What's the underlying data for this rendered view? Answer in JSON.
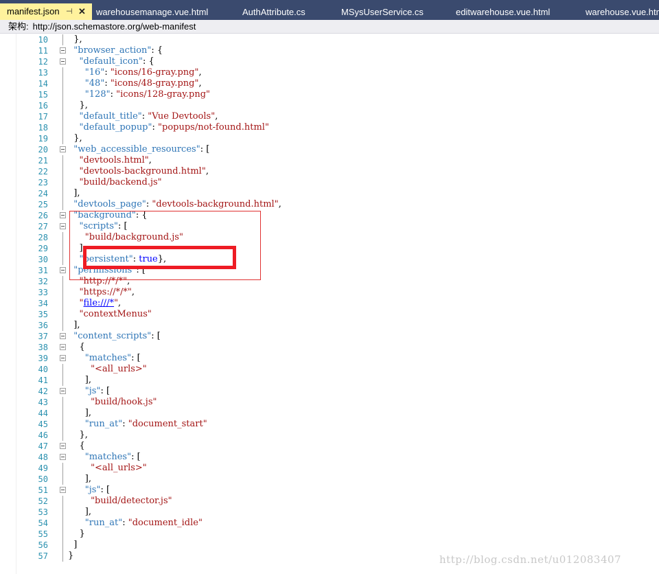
{
  "tabs": [
    {
      "label": "manifest.json",
      "active": true
    },
    {
      "label": "warehousemanage.vue.html"
    },
    {
      "label": "AuthAttribute.cs"
    },
    {
      "label": "MSysUserService.cs"
    },
    {
      "label": "editwarehouse.vue.html"
    },
    {
      "label": "warehouse.vue.html"
    }
  ],
  "tab_icons": {
    "pin": "pin-icon",
    "close": "close-icon"
  },
  "schema": {
    "label": "架构:",
    "url": "http://json.schemastore.org/web-manifest"
  },
  "colors": {
    "tabbar_bg": "#3a4a6e",
    "active_tab_bg": "#fff29d",
    "line_number": "#2b91af",
    "json_key": "#2e75b6",
    "json_string": "#a31515",
    "json_keyword": "#0000ff",
    "highlight_red": "#ee1c24"
  },
  "lines": [
    {
      "n": "10",
      "fold": false,
      "tokens": [
        {
          "t": "p",
          "s": "  },"
        }
      ]
    },
    {
      "n": "11",
      "fold": true,
      "tokens": [
        {
          "t": "p",
          "s": "  "
        },
        {
          "t": "key",
          "s": "\"browser_action\""
        },
        {
          "t": "p",
          "s": ": {"
        }
      ]
    },
    {
      "n": "12",
      "fold": true,
      "tokens": [
        {
          "t": "p",
          "s": "    "
        },
        {
          "t": "key",
          "s": "\"default_icon\""
        },
        {
          "t": "p",
          "s": ": {"
        }
      ]
    },
    {
      "n": "13",
      "fold": false,
      "tokens": [
        {
          "t": "p",
          "s": "      "
        },
        {
          "t": "key",
          "s": "\"16\""
        },
        {
          "t": "p",
          "s": ": "
        },
        {
          "t": "str",
          "s": "\"icons/16-gray.png\""
        },
        {
          "t": "p",
          "s": ","
        }
      ]
    },
    {
      "n": "14",
      "fold": false,
      "tokens": [
        {
          "t": "p",
          "s": "      "
        },
        {
          "t": "key",
          "s": "\"48\""
        },
        {
          "t": "p",
          "s": ": "
        },
        {
          "t": "str",
          "s": "\"icons/48-gray.png\""
        },
        {
          "t": "p",
          "s": ","
        }
      ]
    },
    {
      "n": "15",
      "fold": false,
      "tokens": [
        {
          "t": "p",
          "s": "      "
        },
        {
          "t": "key",
          "s": "\"128\""
        },
        {
          "t": "p",
          "s": ": "
        },
        {
          "t": "str",
          "s": "\"icons/128-gray.png\""
        }
      ]
    },
    {
      "n": "16",
      "fold": false,
      "tokens": [
        {
          "t": "p",
          "s": "    },"
        }
      ]
    },
    {
      "n": "17",
      "fold": false,
      "tokens": [
        {
          "t": "p",
          "s": "    "
        },
        {
          "t": "key",
          "s": "\"default_title\""
        },
        {
          "t": "p",
          "s": ": "
        },
        {
          "t": "str",
          "s": "\"Vue Devtools\""
        },
        {
          "t": "p",
          "s": ","
        }
      ]
    },
    {
      "n": "18",
      "fold": false,
      "tokens": [
        {
          "t": "p",
          "s": "    "
        },
        {
          "t": "key",
          "s": "\"default_popup\""
        },
        {
          "t": "p",
          "s": ": "
        },
        {
          "t": "str",
          "s": "\"popups/not-found.html\""
        }
      ]
    },
    {
      "n": "19",
      "fold": false,
      "tokens": [
        {
          "t": "p",
          "s": "  },"
        }
      ]
    },
    {
      "n": "20",
      "fold": true,
      "tokens": [
        {
          "t": "p",
          "s": "  "
        },
        {
          "t": "key",
          "s": "\"web_accessible_resources\""
        },
        {
          "t": "p",
          "s": ": ["
        }
      ]
    },
    {
      "n": "21",
      "fold": false,
      "tokens": [
        {
          "t": "p",
          "s": "    "
        },
        {
          "t": "str",
          "s": "\"devtools.html\""
        },
        {
          "t": "p",
          "s": ","
        }
      ]
    },
    {
      "n": "22",
      "fold": false,
      "tokens": [
        {
          "t": "p",
          "s": "    "
        },
        {
          "t": "str",
          "s": "\"devtools-background.html\""
        },
        {
          "t": "p",
          "s": ","
        }
      ]
    },
    {
      "n": "23",
      "fold": false,
      "tokens": [
        {
          "t": "p",
          "s": "    "
        },
        {
          "t": "str",
          "s": "\"build/backend.js\""
        }
      ]
    },
    {
      "n": "24",
      "fold": false,
      "tokens": [
        {
          "t": "p",
          "s": "  ],"
        }
      ]
    },
    {
      "n": "25",
      "fold": false,
      "tokens": [
        {
          "t": "p",
          "s": "  "
        },
        {
          "t": "key",
          "s": "\"devtools_page\""
        },
        {
          "t": "p",
          "s": ": "
        },
        {
          "t": "str",
          "s": "\"devtools-background.html\""
        },
        {
          "t": "p",
          "s": ","
        }
      ]
    },
    {
      "n": "26",
      "fold": true,
      "tokens": [
        {
          "t": "p",
          "s": "  "
        },
        {
          "t": "key",
          "s": "\"background\""
        },
        {
          "t": "p",
          "s": ": {"
        }
      ]
    },
    {
      "n": "27",
      "fold": true,
      "tokens": [
        {
          "t": "p",
          "s": "    "
        },
        {
          "t": "key",
          "s": "\"scripts\""
        },
        {
          "t": "p",
          "s": ": ["
        }
      ]
    },
    {
      "n": "28",
      "fold": false,
      "tokens": [
        {
          "t": "p",
          "s": "      "
        },
        {
          "t": "str",
          "s": "\"build/background.js\""
        }
      ]
    },
    {
      "n": "29",
      "fold": false,
      "tokens": [
        {
          "t": "p",
          "s": "    ],"
        }
      ]
    },
    {
      "n": "30",
      "fold": false,
      "tokens": [
        {
          "t": "p",
          "s": "    "
        },
        {
          "t": "key",
          "s": "\"persistent\""
        },
        {
          "t": "p",
          "s": ": "
        },
        {
          "t": "kw",
          "s": "true"
        },
        {
          "t": "p",
          "s": "},"
        }
      ]
    },
    {
      "n": "31",
      "fold": true,
      "tokens": [
        {
          "t": "p",
          "s": "  "
        },
        {
          "t": "key",
          "s": "\"permissions\""
        },
        {
          "t": "p",
          "s": ": ["
        }
      ]
    },
    {
      "n": "32",
      "fold": false,
      "tokens": [
        {
          "t": "p",
          "s": "    "
        },
        {
          "t": "str",
          "s": "\"http://*/*\""
        },
        {
          "t": "p",
          "s": ","
        }
      ]
    },
    {
      "n": "33",
      "fold": false,
      "tokens": [
        {
          "t": "p",
          "s": "    "
        },
        {
          "t": "str",
          "s": "\"https://*/*\""
        },
        {
          "t": "p",
          "s": ","
        }
      ]
    },
    {
      "n": "34",
      "fold": false,
      "tokens": [
        {
          "t": "p",
          "s": "    "
        },
        {
          "t": "str",
          "s": "\""
        },
        {
          "t": "lnk",
          "s": "file:///*"
        },
        {
          "t": "str",
          "s": "\""
        },
        {
          "t": "p",
          "s": ","
        }
      ]
    },
    {
      "n": "35",
      "fold": false,
      "tokens": [
        {
          "t": "p",
          "s": "    "
        },
        {
          "t": "str",
          "s": "\"contextMenus\""
        }
      ]
    },
    {
      "n": "36",
      "fold": false,
      "tokens": [
        {
          "t": "p",
          "s": "  ],"
        }
      ]
    },
    {
      "n": "37",
      "fold": true,
      "tokens": [
        {
          "t": "p",
          "s": "  "
        },
        {
          "t": "key",
          "s": "\"content_scripts\""
        },
        {
          "t": "p",
          "s": ": ["
        }
      ]
    },
    {
      "n": "38",
      "fold": true,
      "tokens": [
        {
          "t": "p",
          "s": "    {"
        }
      ]
    },
    {
      "n": "39",
      "fold": true,
      "tokens": [
        {
          "t": "p",
          "s": "      "
        },
        {
          "t": "key",
          "s": "\"matches\""
        },
        {
          "t": "p",
          "s": ": ["
        }
      ]
    },
    {
      "n": "40",
      "fold": false,
      "tokens": [
        {
          "t": "p",
          "s": "        "
        },
        {
          "t": "str",
          "s": "\"<all_urls>\""
        }
      ]
    },
    {
      "n": "41",
      "fold": false,
      "tokens": [
        {
          "t": "p",
          "s": "      ],"
        }
      ]
    },
    {
      "n": "42",
      "fold": true,
      "tokens": [
        {
          "t": "p",
          "s": "      "
        },
        {
          "t": "key",
          "s": "\"js\""
        },
        {
          "t": "p",
          "s": ": ["
        }
      ]
    },
    {
      "n": "43",
      "fold": false,
      "tokens": [
        {
          "t": "p",
          "s": "        "
        },
        {
          "t": "str",
          "s": "\"build/hook.js\""
        }
      ]
    },
    {
      "n": "44",
      "fold": false,
      "tokens": [
        {
          "t": "p",
          "s": "      ],"
        }
      ]
    },
    {
      "n": "45",
      "fold": false,
      "tokens": [
        {
          "t": "p",
          "s": "      "
        },
        {
          "t": "key",
          "s": "\"run_at\""
        },
        {
          "t": "p",
          "s": ": "
        },
        {
          "t": "str",
          "s": "\"document_start\""
        }
      ]
    },
    {
      "n": "46",
      "fold": false,
      "tokens": [
        {
          "t": "p",
          "s": "    },"
        }
      ]
    },
    {
      "n": "47",
      "fold": true,
      "tokens": [
        {
          "t": "p",
          "s": "    {"
        }
      ]
    },
    {
      "n": "48",
      "fold": true,
      "tokens": [
        {
          "t": "p",
          "s": "      "
        },
        {
          "t": "key",
          "s": "\"matches\""
        },
        {
          "t": "p",
          "s": ": ["
        }
      ]
    },
    {
      "n": "49",
      "fold": false,
      "tokens": [
        {
          "t": "p",
          "s": "        "
        },
        {
          "t": "str",
          "s": "\"<all_urls>\""
        }
      ]
    },
    {
      "n": "50",
      "fold": false,
      "tokens": [
        {
          "t": "p",
          "s": "      ],"
        }
      ]
    },
    {
      "n": "51",
      "fold": true,
      "tokens": [
        {
          "t": "p",
          "s": "      "
        },
        {
          "t": "key",
          "s": "\"js\""
        },
        {
          "t": "p",
          "s": ": ["
        }
      ]
    },
    {
      "n": "52",
      "fold": false,
      "tokens": [
        {
          "t": "p",
          "s": "        "
        },
        {
          "t": "str",
          "s": "\"build/detector.js\""
        }
      ]
    },
    {
      "n": "53",
      "fold": false,
      "tokens": [
        {
          "t": "p",
          "s": "      ],"
        }
      ]
    },
    {
      "n": "54",
      "fold": false,
      "tokens": [
        {
          "t": "p",
          "s": "      "
        },
        {
          "t": "key",
          "s": "\"run_at\""
        },
        {
          "t": "p",
          "s": ": "
        },
        {
          "t": "str",
          "s": "\"document_idle\""
        }
      ]
    },
    {
      "n": "55",
      "fold": false,
      "tokens": [
        {
          "t": "p",
          "s": "    }"
        }
      ]
    },
    {
      "n": "56",
      "fold": false,
      "tokens": [
        {
          "t": "p",
          "s": "  ]"
        }
      ]
    },
    {
      "n": "57",
      "fold": false,
      "tokens": [
        {
          "t": "p",
          "s": "}"
        }
      ]
    }
  ],
  "watermark": "http://blog.csdn.net/u012083407"
}
